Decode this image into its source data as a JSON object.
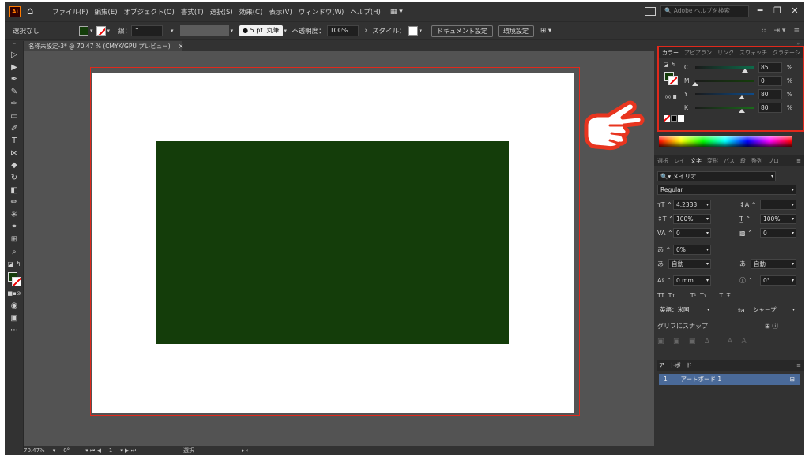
{
  "menubar": {
    "app_logo": "Ai",
    "items": [
      "ファイル(F)",
      "編集(E)",
      "オブジェクト(O)",
      "書式(T)",
      "選択(S)",
      "効果(C)",
      "表示(V)",
      "ウィンドウ(W)",
      "ヘルプ(H)"
    ],
    "search_placeholder": "Adobe ヘルプを検索"
  },
  "controlbar": {
    "selection_status": "選択なし",
    "stroke_label": "線：",
    "brush_label": "5 pt. 丸筆",
    "opacity_label": "不透明度：",
    "opacity_value": "100%",
    "style_label": "スタイル：",
    "doc_settings_button": "ドキュメント設定",
    "preferences_button": "環境設定"
  },
  "document_tab": {
    "title": "名称未設定-3* @ 70.47 % (CMYK/GPU プレビュー)",
    "close": "×"
  },
  "color_panel": {
    "tabs": [
      "カラー",
      "アピアラン",
      "リンク",
      "スウォッチ",
      "グラデーシ"
    ],
    "active_tab": "カラー",
    "channels": [
      {
        "label": "C",
        "value": 85,
        "unit": "%",
        "track": "#0d6b4a"
      },
      {
        "label": "M",
        "value": 0,
        "unit": "%",
        "track": "#143d0a"
      },
      {
        "label": "Y",
        "value": 80,
        "unit": "%",
        "track": "#0d4b8a"
      },
      {
        "label": "K",
        "value": 80,
        "unit": "%",
        "track": "#1a6b1a"
      }
    ],
    "fill_color": "#143d0a"
  },
  "character_panel": {
    "tabs": [
      "選択",
      "レイ",
      "文字",
      "変形",
      "パス",
      "段",
      "整列",
      "プロ"
    ],
    "active_tab": "文字",
    "font_family": "メイリオ",
    "font_style": "Regular",
    "font_size": "4.2333",
    "leading": "",
    "vertical_scale": "100%",
    "horizontal_scale": "100%",
    "kerning": "0",
    "tracking": "0",
    "tsume": "0%",
    "aki_left": "自動",
    "aki_right": "自動",
    "baseline_shift": "0 mm",
    "rotation": "0°",
    "language": "英語：米国",
    "antialias": "シャープ",
    "snap_label": "グリフにスナップ"
  },
  "artboards_panel": {
    "tab": "アートボード",
    "rows": [
      {
        "index": "1",
        "name": "アートボード 1"
      }
    ]
  },
  "statusbar": {
    "zoom": "70.47%",
    "rotation": "0°",
    "artboard_num": "1",
    "tool": "選択"
  },
  "canvas": {
    "bleed_color": "#e0291c",
    "rect_color": "#143d0a",
    "hand_color": "#e8351f"
  }
}
